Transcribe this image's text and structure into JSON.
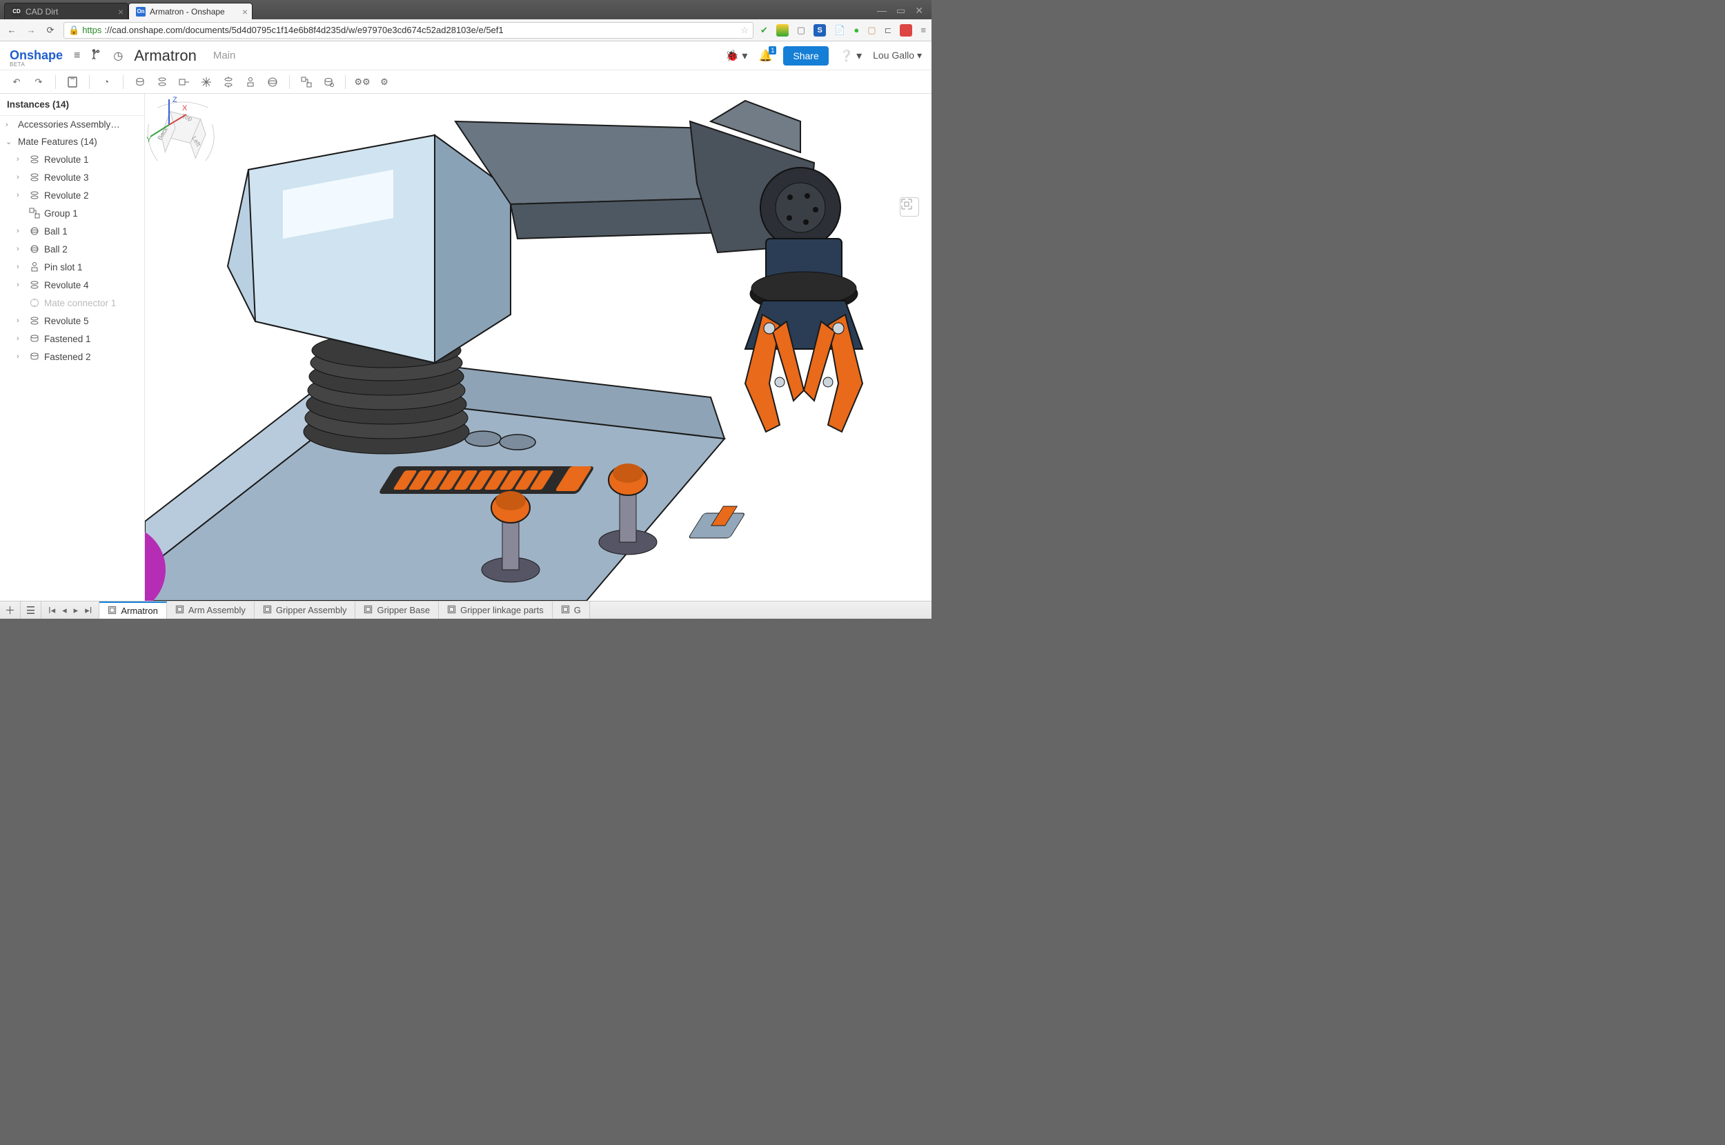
{
  "browser": {
    "tabs": [
      {
        "icon": "CD",
        "title": "CAD Dirt",
        "active": false
      },
      {
        "icon": "On",
        "title": "Armatron - Onshape",
        "active": true
      }
    ],
    "url_prefix": "https",
    "url_rest": "://cad.onshape.com/documents/5d4d0795c1f14e6b8f4d235d/w/e97970e3cd674c52ad28103e/e/5ef1"
  },
  "header": {
    "logo": "Onshape",
    "beta": "BETA",
    "doc_title": "Armatron",
    "doc_sub": "Main",
    "share": "Share",
    "notif_count": "1",
    "user": "Lou Gallo"
  },
  "tree": {
    "title": "Instances (14)",
    "items": [
      {
        "expander": "›",
        "label": "Accessories Assembly…",
        "level": 1
      },
      {
        "expander": "⌄",
        "label": "Mate Features (14)",
        "level": 1,
        "expanded": true
      },
      {
        "expander": "›",
        "icon": "revolute",
        "label": "Revolute 1",
        "level": 2
      },
      {
        "expander": "›",
        "icon": "revolute",
        "label": "Revolute 3",
        "level": 2
      },
      {
        "expander": "›",
        "icon": "revolute",
        "label": "Revolute 2",
        "level": 2
      },
      {
        "expander": "",
        "icon": "group",
        "label": "Group 1",
        "level": 2
      },
      {
        "expander": "›",
        "icon": "ball",
        "label": "Ball 1",
        "level": 2
      },
      {
        "expander": "›",
        "icon": "ball",
        "label": "Ball 2",
        "level": 2
      },
      {
        "expander": "›",
        "icon": "pinslot",
        "label": "Pin slot 1",
        "level": 2
      },
      {
        "expander": "›",
        "icon": "revolute",
        "label": "Revolute 4",
        "level": 2
      },
      {
        "expander": "",
        "icon": "mateconn",
        "label": "Mate connector 1",
        "level": 2,
        "disabled": true
      },
      {
        "expander": "›",
        "icon": "revolute",
        "label": "Revolute 5",
        "level": 2
      },
      {
        "expander": "›",
        "icon": "fastened",
        "label": "Fastened 1",
        "level": 2
      },
      {
        "expander": "›",
        "icon": "fastened",
        "label": "Fastened 2",
        "level": 2
      }
    ]
  },
  "bottom_tabs": [
    {
      "label": "Armatron",
      "active": true
    },
    {
      "label": "Arm Assembly"
    },
    {
      "label": "Gripper Assembly"
    },
    {
      "label": "Gripper Base"
    },
    {
      "label": "Gripper linkage parts"
    },
    {
      "label": "G"
    }
  ],
  "viewcube": {
    "top": "Top",
    "back": "Back",
    "left": "Left",
    "x": "X",
    "y": "Y",
    "z": "Z"
  }
}
